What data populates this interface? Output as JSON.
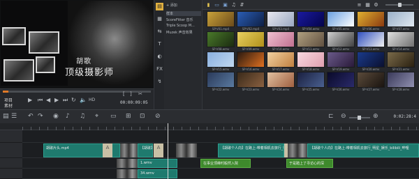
{
  "preview": {
    "title_main": "胡歌",
    "title_sub": "顶级摄影师",
    "project_label": "项目",
    "clip_label": "素材",
    "timecode": "00:00:09:05",
    "hd_label": "HD"
  },
  "library": {
    "add_label": "添加",
    "folders": [
      "样本",
      "ScoreFitter 音乐",
      "Triple Scoop M...",
      "Muzek 声音效果"
    ],
    "thumbs": [
      {
        "label": "SP-V01.mp4",
        "c1": "#c9a23a",
        "c2": "#6b4a1a"
      },
      {
        "label": "SP-V02.mp4",
        "c1": "#2a5db5",
        "c2": "#0e1f44"
      },
      {
        "label": "SP-V03.mp4",
        "c1": "#e8e8f0",
        "c2": "#9aa8c0"
      },
      {
        "label": "SP-V04.wmv",
        "c1": "#1a1aa0",
        "c2": "#04044a"
      },
      {
        "label": "SP-V05.wmv",
        "c1": "#6aa0e0",
        "c2": "#ffffff"
      },
      {
        "label": "SP-V06.wmv",
        "c1": "#e0b030",
        "c2": "#8a3a10"
      },
      {
        "label": "SP-V07.wmv",
        "c1": "#9ab0c8",
        "c2": "#e0e8f0"
      },
      {
        "label": "SP-V08.wmv",
        "c1": "#4a7a2a",
        "c2": "#1a2a10"
      },
      {
        "label": "SP-V09.wmv",
        "c1": "#e8d060",
        "c2": "#b0901a"
      },
      {
        "label": "SP-V10.wmv",
        "c1": "#f0c0d0",
        "c2": "#c07090"
      },
      {
        "label": "SP-V11.wmv",
        "c1": "#b0a080",
        "c2": "#605040"
      },
      {
        "label": "SP-V12.wmv",
        "c1": "#d0d0d0",
        "c2": "#404040"
      },
      {
        "label": "SP-V13.wmv",
        "c1": "#3050c0",
        "c2": "#f0f0f0"
      },
      {
        "label": "SP-V14.wmv",
        "c1": "#e0e0e0",
        "c2": "#707070"
      },
      {
        "label": "SP-V15.wmv",
        "c1": "#8ab0e0",
        "c2": "#c0d8f0"
      },
      {
        "label": "SP-V16.wmv",
        "c1": "#2a1a10",
        "c2": "#e07020"
      },
      {
        "label": "SP-V17.wmv",
        "c1": "#f0d0a0",
        "c2": "#c08040"
      },
      {
        "label": "SP-V18.wmv",
        "c1": "#f8d8e0",
        "c2": "#e0a0b0"
      },
      {
        "label": "SP-V19.wmv",
        "c1": "#6a5a8a",
        "c2": "#2a1a3a"
      },
      {
        "label": "SP-V20.wmv",
        "c1": "#1a3a8a",
        "c2": "#0a1030"
      },
      {
        "label": "SP-V21.wmv",
        "c1": "#7a6a4a",
        "c2": "#2a2010"
      },
      {
        "label": "SP-V22.wmv",
        "c1": "#2a3a5a",
        "c2": "#5a7aa0"
      },
      {
        "label": "SP-V23.wmv",
        "c1": "#3a2a1a",
        "c2": "#8a6040"
      },
      {
        "label": "SP-V24.wmv",
        "c1": "#e0c0a0",
        "c2": "#a06040"
      },
      {
        "label": "SP-V25.wmv",
        "c1": "#1a2040",
        "c2": "#4a6090"
      },
      {
        "label": "SP-V26.wmv",
        "c1": "#0a0a2a",
        "c2": "#2a2a6a"
      },
      {
        "label": "SP-V27.wmv",
        "c1": "#5a4a3a",
        "c2": "#1a1410"
      },
      {
        "label": "SP-V28.wmv",
        "c1": "#3a3a5a",
        "c2": "#9090b0"
      }
    ]
  },
  "timeline": {
    "timecode": "0:02:28:4",
    "clips": {
      "v1": "胡歌片头.mp4",
      "v2": "【胡歌】",
      "v3": "【胡歌个人向】在路上-带着相机去旅行_明星_娱乐_bilibili",
      "v4": "【胡歌个人向】在路上-带着相机去旅行_明星_娱乐_bilibili_哔哩",
      "o1": "1.wmv",
      "o2": "34.wmv",
      "t1": "在事业顶峰时毅然入院",
      "t2": "于是踏上了寻访心的深"
    }
  }
}
